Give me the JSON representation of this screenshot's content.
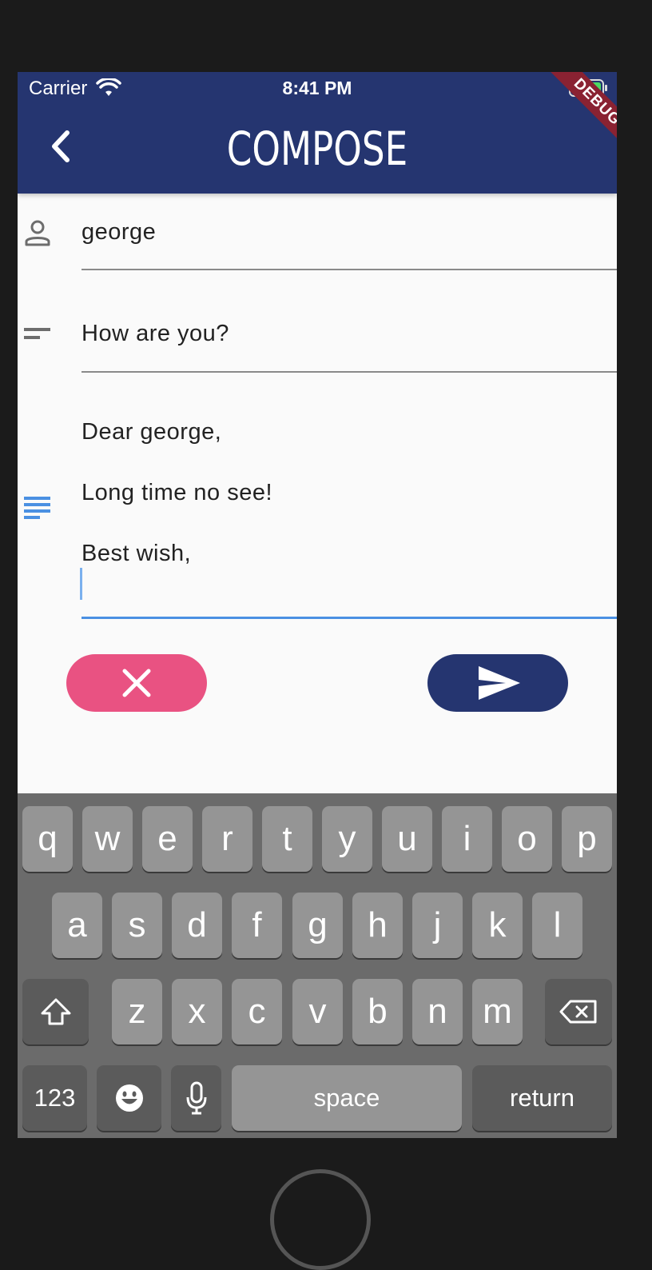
{
  "status_bar": {
    "carrier": "Carrier",
    "time": "8:41 PM",
    "wifi_icon": "wifi-icon",
    "battery_icon": "battery-charging-icon"
  },
  "debug_banner": "DEBUG",
  "app_bar": {
    "title": "COMPOSE",
    "back_icon": "chevron-left-icon",
    "background": "#253570"
  },
  "form": {
    "recipient": {
      "icon": "person-icon",
      "value": "george"
    },
    "subject": {
      "icon": "short-text-icon",
      "value": "How are you?"
    },
    "body": {
      "icon": "notes-icon",
      "lines": [
        "Dear george,",
        "Long time no see!",
        "Best wish,"
      ],
      "active_color": "#4a90e2"
    }
  },
  "actions": {
    "cancel_icon": "close-icon",
    "cancel_color": "#e95282",
    "send_icon": "send-icon",
    "send_color": "#253570"
  },
  "keyboard": {
    "row1": [
      "q",
      "w",
      "e",
      "r",
      "t",
      "y",
      "u",
      "i",
      "o",
      "p"
    ],
    "row2": [
      "a",
      "s",
      "d",
      "f",
      "g",
      "h",
      "j",
      "k",
      "l"
    ],
    "row3": [
      "z",
      "x",
      "c",
      "v",
      "b",
      "n",
      "m"
    ],
    "numbers_label": "123",
    "space_label": "space",
    "return_label": "return",
    "shift_icon": "shift-icon",
    "backspace_icon": "backspace-icon",
    "emoji_icon": "emoji-icon",
    "mic_icon": "microphone-icon"
  }
}
